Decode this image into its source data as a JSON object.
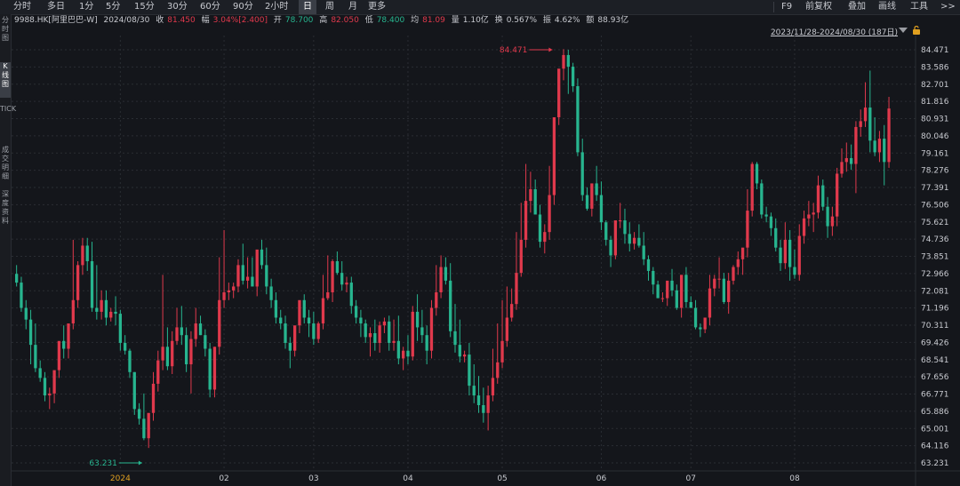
{
  "toolbar": {
    "timeframes": [
      "分时",
      "多日",
      "1分",
      "5分",
      "15分",
      "30分",
      "60分",
      "90分",
      "2小时",
      "日",
      "周",
      "月",
      "更多"
    ],
    "active_timeframe": "日",
    "right_items": [
      "F9",
      "前复权",
      "叠加",
      "画线",
      "工具",
      ">>"
    ]
  },
  "info": {
    "symbol": "9988.HK[阿里巴巴-W]",
    "date": "2024/08/30",
    "close_label": "收",
    "close": "81.450",
    "change_label": "幅",
    "change": "3.04%[2.400]",
    "open_label": "开",
    "open": "78.700",
    "high_label": "高",
    "high": "82.050",
    "low_label": "低",
    "low": "78.400",
    "avg_label": "均",
    "avg": "81.09",
    "volume_label": "量",
    "volume": "1.10亿",
    "turnover_label": "换",
    "turnover": "0.567%",
    "amplitude_label": "振",
    "amplitude": "4.62%",
    "amount_label": "额",
    "amount": "88.93亿"
  },
  "left_sidebar": [
    "分时图",
    "K线图",
    "TICK",
    "成交明细",
    "深度资料"
  ],
  "range_text": "2023/11/28-2024/08/30 (187日)",
  "colors": {
    "up": "#e0394c",
    "down": "#27b58f",
    "background": "#14161b",
    "grid": "#2a2d33"
  },
  "chart_data": {
    "type": "candlestick",
    "x": [
      "2023-11-28",
      "2023-11-29",
      "2023-11-30",
      "2023-12-01",
      "2023-12-04",
      "2023-12-05",
      "2023-12-06",
      "2023-12-07",
      "2023-12-08",
      "2023-12-11",
      "2023-12-12",
      "2023-12-13",
      "2023-12-14",
      "2023-12-15",
      "2023-12-18",
      "2023-12-19",
      "2023-12-20",
      "2023-12-21",
      "2023-12-22",
      "2023-12-27",
      "2023-12-28",
      "2023-12-29",
      "2024-01-02",
      "2024-01-03",
      "2024-01-04",
      "2024-01-05",
      "2024-01-08",
      "2024-01-09",
      "2024-01-10",
      "2024-01-11",
      "2024-01-12",
      "2024-01-15",
      "2024-01-16",
      "2024-01-17",
      "2024-01-18",
      "2024-01-19",
      "2024-01-22",
      "2024-01-23",
      "2024-01-24",
      "2024-01-25",
      "2024-01-26",
      "2024-01-29",
      "2024-01-30",
      "2024-01-31",
      "2024-02-01",
      "2024-02-02",
      "2024-02-05",
      "2024-02-06",
      "2024-02-07",
      "2024-02-08",
      "2024-02-09",
      "2024-02-14",
      "2024-02-15",
      "2024-02-16",
      "2024-02-19",
      "2024-02-20",
      "2024-02-21",
      "2024-02-22",
      "2024-02-23",
      "2024-02-26",
      "2024-02-27",
      "2024-02-28",
      "2024-02-29",
      "2024-03-01",
      "2024-03-04",
      "2024-03-05",
      "2024-03-06",
      "2024-03-07",
      "2024-03-08",
      "2024-03-11",
      "2024-03-12",
      "2024-03-13",
      "2024-03-14",
      "2024-03-15",
      "2024-03-18",
      "2024-03-19",
      "2024-03-20",
      "2024-03-21",
      "2024-03-22",
      "2024-03-25",
      "2024-03-26",
      "2024-03-27",
      "2024-03-28",
      "2024-04-02",
      "2024-04-03",
      "2024-04-05",
      "2024-04-08",
      "2024-04-09",
      "2024-04-10",
      "2024-04-11",
      "2024-04-12",
      "2024-04-15",
      "2024-04-16",
      "2024-04-17",
      "2024-04-18",
      "2024-04-19",
      "2024-04-22",
      "2024-04-23",
      "2024-04-24",
      "2024-04-25",
      "2024-04-26",
      "2024-04-29",
      "2024-04-30",
      "2024-05-02",
      "2024-05-03",
      "2024-05-06",
      "2024-05-07",
      "2024-05-08",
      "2024-05-09",
      "2024-05-10",
      "2024-05-13",
      "2024-05-14",
      "2024-05-16",
      "2024-05-17",
      "2024-05-20",
      "2024-05-21",
      "2024-05-22",
      "2024-05-23",
      "2024-05-24",
      "2024-05-27",
      "2024-05-28",
      "2024-05-29",
      "2024-05-30",
      "2024-05-31",
      "2024-06-03",
      "2024-06-04",
      "2024-06-05",
      "2024-06-06",
      "2024-06-07",
      "2024-06-11",
      "2024-06-12",
      "2024-06-13",
      "2024-06-14",
      "2024-06-17",
      "2024-06-18",
      "2024-06-19",
      "2024-06-20",
      "2024-06-21",
      "2024-06-24",
      "2024-06-25",
      "2024-06-26",
      "2024-06-27",
      "2024-06-28",
      "2024-07-02",
      "2024-07-03",
      "2024-07-04",
      "2024-07-05",
      "2024-07-08",
      "2024-07-09",
      "2024-07-10",
      "2024-07-11",
      "2024-07-12",
      "2024-07-15",
      "2024-07-16",
      "2024-07-17",
      "2024-07-18",
      "2024-07-19",
      "2024-07-22",
      "2024-07-23",
      "2024-07-24",
      "2024-07-25",
      "2024-07-26",
      "2024-07-29",
      "2024-07-30",
      "2024-07-31",
      "2024-08-01",
      "2024-08-02",
      "2024-08-05",
      "2024-08-06",
      "2024-08-07",
      "2024-08-08",
      "2024-08-09",
      "2024-08-12",
      "2024-08-13",
      "2024-08-14",
      "2024-08-15",
      "2024-08-16",
      "2024-08-19",
      "2024-08-20",
      "2024-08-21",
      "2024-08-22",
      "2024-08-23",
      "2024-08-26",
      "2024-08-27",
      "2024-08-28",
      "2024-08-29",
      "2024-08-30"
    ],
    "open": [
      72.95,
      72.5,
      71.2,
      70.6,
      69.3,
      68.1,
      67.6,
      66.7,
      66.8,
      68.0,
      69.5,
      69.1,
      70.4,
      71.6,
      73.4,
      74.4,
      73.6,
      71.2,
      71.0,
      71.6,
      70.7,
      71.0,
      70.9,
      69.4,
      69.0,
      67.9,
      66.0,
      65.5,
      64.5,
      65.8,
      67.3,
      68.5,
      69.2,
      68.2,
      69.5,
      70.2,
      69.8,
      68.3,
      69.6,
      70.4,
      69.8,
      69.1,
      67.0,
      69.2,
      71.6,
      72.0,
      72.1,
      72.3,
      73.4,
      72.6,
      72.8,
      72.3,
      74.2,
      73.4,
      72.3,
      71.6,
      70.7,
      70.4,
      69.4,
      69.0,
      70.3,
      71.6,
      70.7,
      70.4,
      69.6,
      70.4,
      71.7,
      72.0,
      73.6,
      73.0,
      72.4,
      72.5,
      71.3,
      70.7,
      70.4,
      69.7,
      69.9,
      69.4,
      70.3,
      70.5,
      69.4,
      69.5,
      68.6,
      69.0,
      68.7,
      71.0,
      70.2,
      69.8,
      69.0,
      71.2,
      72.0,
      73.3,
      72.6,
      70.0,
      69.3,
      68.7,
      68.8,
      67.2,
      66.7,
      66.2,
      65.8,
      66.7,
      67.6,
      68.4,
      69.5,
      70.7,
      71.4,
      73.0,
      74.7,
      76.7,
      77.3,
      76.0,
      74.6,
      75.1,
      77.0,
      81.0,
      83.5,
      84.2,
      83.6,
      82.6,
      79.2,
      77.0,
      76.3,
      77.6,
      77.0,
      75.6,
      74.7,
      73.9,
      75.7,
      75.7,
      75.0,
      74.5,
      74.8,
      74.4,
      73.7,
      73.1,
      72.4,
      71.7,
      71.7,
      72.6,
      72.1,
      71.2,
      72.9,
      71.5,
      71.2,
      70.2,
      70.1,
      70.7,
      72.2,
      72.7,
      72.7,
      71.5,
      72.6,
      73.3,
      73.7,
      74.3,
      76.2,
      78.6,
      77.6,
      76.0,
      75.9,
      75.3,
      74.3,
      73.5,
      74.7,
      73.3,
      72.9,
      74.9,
      75.8,
      76.0,
      76.1,
      77.5,
      76.4,
      75.4,
      75.9,
      78.1,
      78.7,
      78.9,
      78.6,
      80.5,
      80.8,
      81.5,
      79.8,
      79.2,
      79.9,
      78.7
    ],
    "high": [
      73.4,
      72.8,
      71.6,
      71.1,
      70.4,
      68.5,
      67.9,
      67.1,
      67.7,
      69.4,
      70.3,
      70.0,
      74.7,
      73.6,
      74.8,
      74.8,
      74.6,
      73.4,
      72.1,
      72.1,
      71.2,
      71.8,
      71.1,
      69.8,
      69.1,
      67.9,
      66.3,
      66.8,
      65.6,
      67.9,
      69.0,
      72.9,
      70.2,
      70.0,
      71.2,
      71.3,
      70.2,
      70.0,
      71.2,
      70.8,
      70.1,
      69.4,
      69.2,
      73.8,
      75.2,
      72.5,
      72.5,
      73.7,
      74.5,
      73.8,
      73.8,
      73.9,
      74.7,
      74.3,
      72.7,
      72.0,
      71.1,
      70.8,
      69.7,
      70.0,
      70.9,
      71.9,
      71.1,
      71.0,
      70.5,
      72.9,
      73.9,
      73.7,
      74.1,
      73.6,
      72.8,
      72.8,
      71.6,
      71.1,
      70.6,
      70.2,
      70.6,
      70.5,
      70.7,
      70.8,
      70.6,
      70.8,
      69.2,
      69.8,
      71.3,
      71.9,
      71.1,
      70.3,
      71.6,
      73.4,
      73.9,
      73.8,
      73.5,
      71.4,
      70.6,
      69.0,
      69.4,
      68.3,
      67.7,
      67.1,
      67.2,
      69.1,
      70.4,
      71.6,
      72.3,
      72.2,
      75.1,
      76.6,
      78.6,
      78.2,
      77.8,
      76.5,
      75.5,
      78.5,
      80.4,
      82.8,
      84.5,
      84.47,
      83.8,
      83.0,
      79.9,
      77.4,
      77.4,
      78.5,
      77.7,
      75.7,
      74.9,
      74.8,
      76.6,
      76.3,
      75.6,
      75.1,
      75.5,
      75.1,
      73.9,
      73.3,
      72.6,
      72.0,
      72.3,
      73.2,
      72.4,
      72.5,
      73.3,
      71.8,
      71.6,
      70.4,
      70.6,
      72.9,
      72.9,
      73.8,
      73.0,
      73.0,
      73.4,
      74.1,
      74.1,
      77.3,
      78.7,
      78.7,
      77.8,
      76.4,
      76.1,
      75.8,
      74.7,
      75.6,
      75.2,
      74.2,
      75.5,
      76.2,
      76.7,
      76.6,
      78.0,
      77.8,
      76.9,
      76.4,
      78.4,
      79.4,
      79.7,
      79.6,
      80.8,
      81.4,
      82.8,
      83.4,
      81.0,
      80.3,
      80.6,
      82.05
    ],
    "low": [
      72.3,
      71.0,
      70.1,
      68.3,
      67.9,
      67.4,
      66.4,
      66.0,
      66.3,
      67.6,
      68.6,
      68.6,
      70.1,
      71.2,
      72.9,
      73.1,
      71.0,
      70.6,
      70.6,
      70.3,
      70.5,
      70.3,
      69.0,
      68.8,
      67.6,
      65.7,
      65.2,
      64.4,
      64.0,
      65.4,
      66.9,
      68.0,
      68.0,
      67.8,
      69.3,
      69.3,
      67.9,
      66.8,
      69.2,
      69.8,
      68.7,
      66.6,
      66.6,
      68.8,
      71.2,
      71.6,
      71.7,
      72.0,
      72.4,
      72.2,
      72.3,
      71.8,
      73.2,
      71.9,
      71.2,
      70.4,
      70.1,
      69.1,
      68.1,
      68.7,
      69.9,
      70.4,
      69.7,
      69.3,
      69.4,
      70.1,
      71.6,
      71.5,
      72.9,
      72.1,
      72.0,
      70.9,
      70.4,
      69.7,
      69.4,
      68.7,
      69.0,
      68.9,
      69.9,
      69.0,
      69.0,
      68.3,
      68.0,
      68.3,
      68.5,
      69.5,
      69.4,
      68.3,
      68.6,
      70.8,
      71.7,
      72.4,
      69.7,
      68.9,
      68.4,
      68.4,
      66.7,
      66.3,
      65.8,
      65.3,
      64.9,
      66.4,
      67.3,
      68.1,
      69.2,
      70.5,
      71.1,
      72.8,
      74.3,
      76.1,
      76.1,
      74.3,
      74.0,
      74.7,
      76.5,
      80.6,
      82.9,
      82.2,
      82.3,
      79.0,
      76.7,
      76.2,
      75.9,
      76.7,
      75.2,
      74.4,
      73.3,
      73.7,
      75.3,
      74.5,
      74.1,
      74.2,
      74.3,
      73.4,
      72.6,
      71.9,
      71.7,
      71.5,
      71.3,
      71.8,
      71.1,
      70.7,
      71.2,
      71.2,
      70.1,
      69.7,
      69.9,
      70.3,
      71.8,
      72.2,
      71.4,
      70.9,
      72.4,
      72.9,
      72.9,
      73.8,
      75.9,
      77.3,
      75.8,
      75.6,
      74.9,
      74.1,
      73.1,
      73.2,
      72.6,
      72.7,
      72.6,
      74.5,
      75.4,
      75.1,
      75.8,
      76.2,
      74.8,
      74.9,
      75.4,
      77.9,
      78.2,
      78.3,
      77.1,
      80.0,
      80.5,
      79.2,
      79.0,
      78.7,
      77.5,
      78.4
    ],
    "close": [
      72.5,
      71.2,
      70.6,
      69.3,
      68.1,
      67.6,
      66.7,
      66.8,
      68.0,
      69.5,
      69.1,
      70.4,
      71.6,
      73.4,
      74.4,
      73.6,
      71.2,
      71.0,
      71.6,
      70.7,
      71.0,
      70.9,
      69.4,
      69.0,
      67.9,
      66.0,
      65.5,
      64.5,
      65.8,
      67.3,
      68.5,
      69.2,
      68.2,
      69.5,
      70.2,
      69.8,
      68.3,
      69.6,
      70.4,
      69.8,
      69.1,
      67.0,
      69.2,
      71.6,
      72.0,
      72.1,
      72.3,
      73.4,
      72.6,
      72.8,
      72.3,
      74.2,
      73.4,
      72.3,
      71.6,
      70.7,
      70.4,
      69.4,
      69.0,
      70.3,
      71.6,
      70.7,
      70.4,
      69.6,
      70.4,
      71.7,
      72.0,
      73.6,
      73.0,
      72.4,
      72.5,
      71.3,
      70.7,
      70.4,
      69.7,
      69.9,
      69.4,
      70.3,
      70.5,
      69.4,
      69.5,
      68.6,
      69.0,
      68.7,
      71.0,
      70.2,
      69.8,
      69.0,
      71.2,
      72.0,
      73.3,
      72.6,
      70.0,
      69.3,
      68.7,
      68.8,
      67.2,
      66.7,
      66.2,
      65.8,
      66.7,
      67.6,
      68.4,
      69.5,
      70.7,
      71.4,
      73.0,
      74.7,
      76.7,
      77.3,
      76.0,
      74.6,
      75.1,
      77.0,
      81.0,
      83.5,
      84.2,
      83.6,
      82.6,
      79.2,
      77.0,
      76.3,
      77.6,
      77.0,
      75.6,
      74.7,
      73.9,
      75.7,
      75.7,
      75.0,
      74.5,
      74.8,
      74.4,
      73.7,
      73.1,
      72.4,
      71.7,
      71.7,
      72.6,
      72.1,
      71.2,
      72.9,
      71.5,
      71.2,
      70.2,
      70.1,
      70.7,
      72.2,
      72.7,
      72.7,
      71.5,
      72.6,
      73.3,
      73.7,
      74.3,
      76.2,
      78.6,
      77.6,
      76.0,
      75.9,
      75.3,
      74.3,
      73.5,
      74.7,
      73.3,
      72.9,
      74.9,
      75.8,
      76.0,
      76.1,
      77.5,
      76.4,
      75.4,
      75.9,
      78.1,
      78.7,
      78.9,
      78.6,
      80.5,
      80.8,
      81.5,
      79.8,
      79.2,
      79.9,
      78.7,
      81.45
    ],
    "ylim": [
      63.0,
      84.9
    ],
    "ytick_labels": [
      "84.471",
      "83.586",
      "82.701",
      "81.816",
      "80.931",
      "80.046",
      "79.161",
      "78.276",
      "77.391",
      "76.506",
      "75.621",
      "74.736",
      "73.851",
      "72.966",
      "72.081",
      "71.196",
      "70.311",
      "69.426",
      "68.541",
      "67.656",
      "66.771",
      "65.886",
      "65.001",
      "64.116",
      "63.231"
    ],
    "xtick_labels": [
      {
        "label": "2024",
        "date": "2024-01-02"
      },
      {
        "label": "02",
        "date": "2024-02-01"
      },
      {
        "label": "03",
        "date": "2024-03-01"
      },
      {
        "label": "04",
        "date": "2024-04-02"
      },
      {
        "label": "05",
        "date": "2024-05-02"
      },
      {
        "label": "06",
        "date": "2024-06-03"
      },
      {
        "label": "07",
        "date": "2024-07-02"
      },
      {
        "label": "08",
        "date": "2024-08-01"
      }
    ],
    "annotations": [
      {
        "text": "84.471",
        "value": 84.471,
        "date": "2024-05-20",
        "kind": "max"
      },
      {
        "text": "63.231",
        "value": 63.231,
        "date": "2024-01-09",
        "kind": "min"
      }
    ],
    "grid": true
  }
}
